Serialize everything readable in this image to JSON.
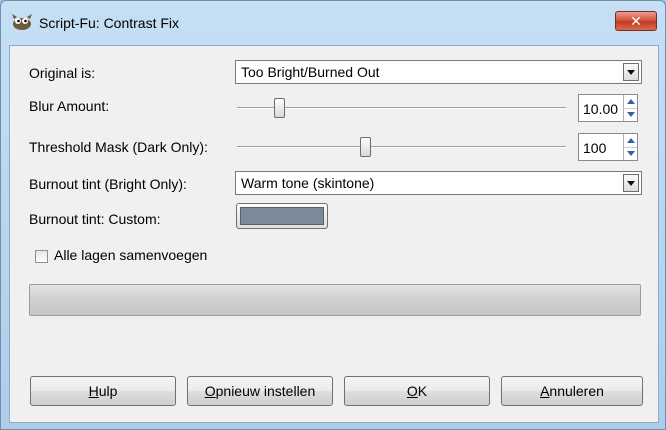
{
  "window": {
    "title": "Script-Fu: Contrast Fix",
    "close_label": "✕"
  },
  "form": {
    "original_label": "Original is:",
    "original_value": "Too Bright/Burned Out",
    "blur_label": "Blur Amount:",
    "blur_value": "10.00",
    "blur_level": 0.13,
    "threshold_label": "Threshold Mask (Dark Only):",
    "threshold_value": "100",
    "threshold_level": 0.39,
    "tint_label": "Burnout tint (Bright Only):",
    "tint_value": "Warm tone (skintone)",
    "custom_label": "Burnout tint: Custom:",
    "custom_color": "#7a8a99",
    "merge_label": "Alle lagen samenvoegen",
    "merge_checked": false
  },
  "buttons": {
    "help": {
      "mnemonic": "H",
      "rest": "ulp"
    },
    "reset": {
      "mnemonic": "O",
      "rest": "pnieuw instellen"
    },
    "ok": {
      "mnemonic": "O",
      "rest": "K"
    },
    "cancel": {
      "mnemonic": "A",
      "rest": "nnuleren"
    }
  },
  "icons": {
    "app": "gimp-wilber-icon",
    "close": "close-icon",
    "combo_arrow": "chevron-down-icon",
    "spin_up": "spin-up-icon",
    "spin_down": "spin-down-icon"
  }
}
